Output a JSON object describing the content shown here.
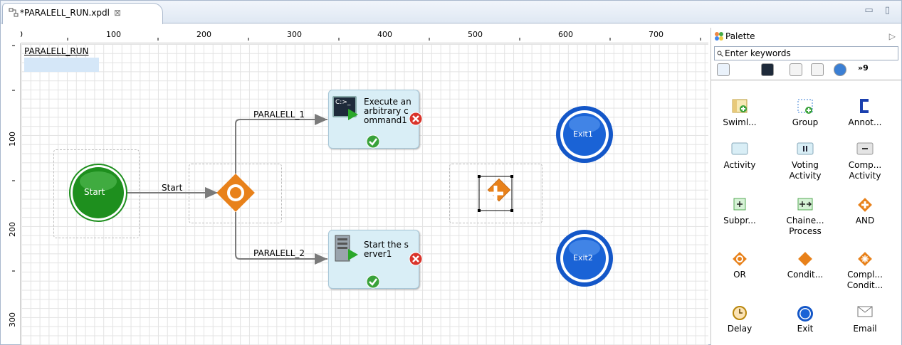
{
  "editor": {
    "tab_title": "*PARALELL_RUN.xpdl",
    "close_glyph": "⊠",
    "window_buttons": "▭ ▯"
  },
  "rulers": {
    "top": [
      "0",
      "100",
      "200",
      "300",
      "400",
      "500",
      "600",
      "700"
    ],
    "left": [
      "100",
      "200",
      "300"
    ]
  },
  "diagram": {
    "process_name": "PARALELL_RUN",
    "start_label": "Start",
    "start_flow_label": "Start",
    "flow1_label": "PARALELL_1",
    "flow2_label": "PARALELL_2",
    "task1_text": "Execute an arbitrary c ommand1",
    "task2_text": "Start the s erver1",
    "task1_icon_text": "C:>_",
    "exit1_label": "Exit1",
    "exit2_label": "Exit2"
  },
  "palette": {
    "title": "Palette",
    "collapse_glyph": "▷",
    "search_placeholder": "Enter keywords",
    "more_tabs": "»9",
    "items": [
      {
        "label": "Swiml...",
        "icon": "swimlane-icon"
      },
      {
        "label": "Group",
        "icon": "group-icon"
      },
      {
        "label": "Annot...",
        "icon": "annotation-icon"
      },
      {
        "label": "Activity",
        "icon": "activity-icon"
      },
      {
        "label": "Voting Activity",
        "icon": "voting-activity-icon"
      },
      {
        "label": "Comp... Activity",
        "icon": "complete-activity-icon"
      },
      {
        "label": "Subpr...",
        "icon": "subprocess-icon"
      },
      {
        "label": "Chaine... Process",
        "icon": "chained-process-icon"
      },
      {
        "label": "AND",
        "icon": "and-gateway-icon"
      },
      {
        "label": "OR",
        "icon": "or-gateway-icon"
      },
      {
        "label": "Condit...",
        "icon": "conditional-gateway-icon"
      },
      {
        "label": "Compl... Condit...",
        "icon": "complex-conditional-icon"
      },
      {
        "label": "Delay",
        "icon": "delay-icon"
      },
      {
        "label": "Exit",
        "icon": "exit-icon"
      },
      {
        "label": "Email",
        "icon": "email-icon"
      }
    ]
  },
  "colors": {
    "start_green": "#1e8f1e",
    "exit_blue": "#1457c8",
    "gateway_orange": "#e8811a",
    "task_fill": "#d9eef6",
    "error_red": "#d9342b",
    "ok_green": "#3aa23a"
  }
}
